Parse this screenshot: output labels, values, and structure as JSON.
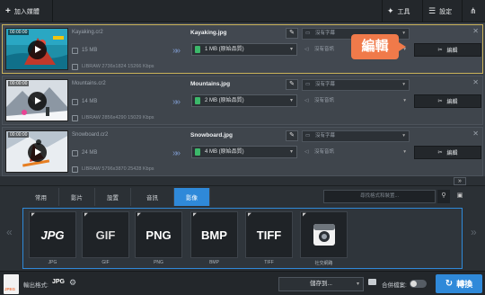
{
  "toolbar": {
    "add_media": "加入媒體",
    "tools": "工具",
    "settings": "設定"
  },
  "files": [
    {
      "time": "00:00:00",
      "name": "Kayaking.cr2",
      "size": "15 MB",
      "info": "LIBRAW 2736x1824 15266 Kbps",
      "output_name": "Kayaking.jpg",
      "output_size": "1 MB (原始品質)",
      "subtitle": "沒有字幕",
      "audio": "沒有音訊",
      "edit": "編輯",
      "selected": true
    },
    {
      "time": "00:00:00",
      "name": "Mountains.cr2",
      "size": "14 MB",
      "info": "LIBRAW 2856x4290 15029 Kbps",
      "output_name": "Mountains.jpg",
      "output_size": "2 MB (原始品質)",
      "subtitle": "沒有字幕",
      "audio": "沒有音訊",
      "edit": "編輯",
      "selected": false
    },
    {
      "time": "00:00:00",
      "name": "Snowboard.cr2",
      "size": "24 MB",
      "info": "LIBRAW 5796x3870 25428 Kbps",
      "output_name": "Snowboard.jpg",
      "output_size": "4 MB (原始品質)",
      "subtitle": "沒有字幕",
      "audio": "沒有音訊",
      "edit": "編輯",
      "selected": false
    }
  ],
  "tooltip": "編輯",
  "tabs": [
    "常用",
    "影片",
    "設置",
    "音訊",
    "影像"
  ],
  "active_tab": "影像",
  "search_placeholder": "尋找格式和裝置...",
  "formats": [
    {
      "badge": "JPG",
      "label": "JPG"
    },
    {
      "badge": "GIF",
      "label": "GIF"
    },
    {
      "badge": "PNG",
      "label": "PNG"
    },
    {
      "badge": "BMP",
      "label": "BMP"
    },
    {
      "badge": "TIFF",
      "label": "TIFF"
    },
    {
      "badge": "",
      "label": "社交網路"
    }
  ],
  "bottom": {
    "format_icon": "JPEG",
    "output_label": "輸出格式:",
    "output_value": "JPG",
    "save_to": "儲存到...",
    "merge": "合併檔案:",
    "convert": "轉換"
  },
  "colors": {
    "accent": "#2f89d9",
    "tooltip": "#f07a4a",
    "selected_border": "#c9b25a",
    "size_icon": "#3cb86a"
  }
}
